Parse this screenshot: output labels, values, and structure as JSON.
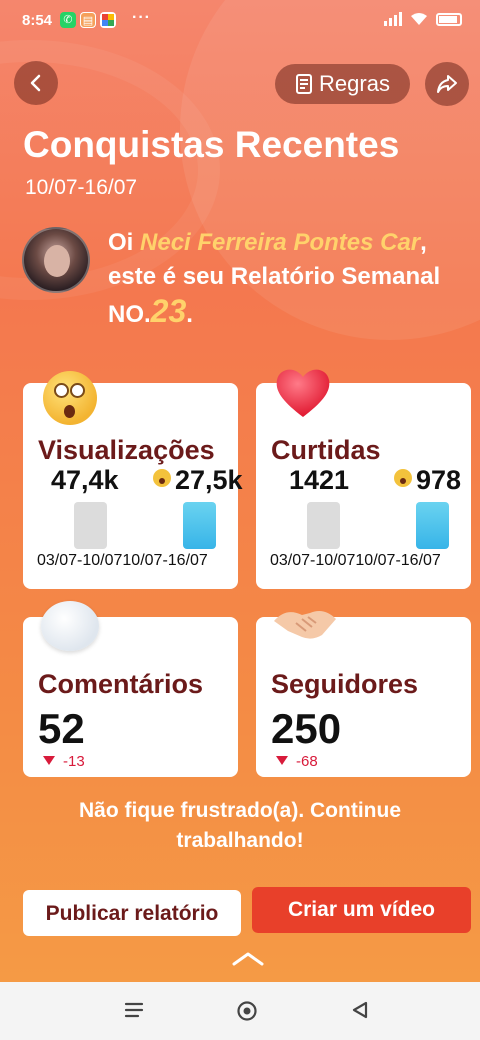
{
  "status_bar": {
    "time": "8:54",
    "more": "···"
  },
  "header": {
    "rules_label": "Regras",
    "title": "Conquistas Recentes",
    "date_range": "10/07-16/07"
  },
  "greeting": {
    "prefix": "Oi ",
    "name": "Neci Ferreira Pontes Car",
    "middle": ", este é seu Relatório Semanal NO.",
    "number": "23",
    "suffix": "."
  },
  "cards": {
    "views": {
      "label": "Visualizações",
      "prev_value": "47,4k",
      "curr_value": "27,5k",
      "prev_dates": "03/07-10/07",
      "curr_dates": "10/07-16/07"
    },
    "likes": {
      "label": "Curtidas",
      "prev_value": "1421",
      "curr_value": "978",
      "prev_dates": "03/07-10/07",
      "curr_dates": "10/07-16/07"
    },
    "comments": {
      "label": "Comentários",
      "value": "52",
      "delta": "-13"
    },
    "followers": {
      "label": "Seguidores",
      "value": "250",
      "delta": "-68"
    }
  },
  "message": "Não fique frustrado(a). Continue trabalhando!",
  "actions": {
    "publish_label": "Publicar relatório",
    "create_label": "Criar um vídeo"
  },
  "colors": {
    "accent": "#e8402a",
    "highlight": "#ffd26b",
    "card_label": "#6b1a1a",
    "negative": "#d81b3b"
  }
}
